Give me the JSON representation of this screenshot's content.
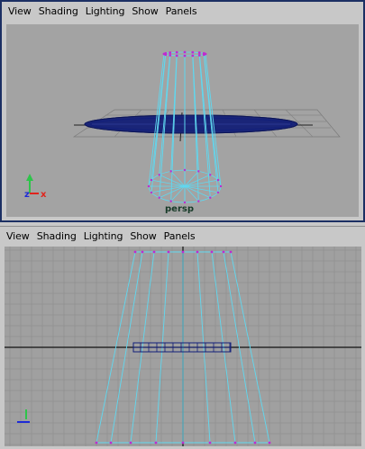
{
  "top_panel": {
    "menu": [
      "View",
      "Shading",
      "Lighting",
      "Show",
      "Panels"
    ],
    "camera_label": "persp",
    "axis_labels": {
      "y": "y",
      "z": "z",
      "x": "x"
    }
  },
  "bottom_panel": {
    "menu": [
      "View",
      "Shading",
      "Lighting",
      "Show",
      "Panels"
    ],
    "axis_labels": {
      "y": "y"
    }
  },
  "colors": {
    "viewport_bg_persp": "#a3a3a3",
    "viewport_bg_front": "#a0a0a0",
    "wire_cyan": "#5fd8f0",
    "wire_dark": "#121f7a",
    "vertex_magenta": "#c02ad0",
    "axis_x": "#e0241c",
    "axis_y": "#2ec44a",
    "axis_z": "#1e2bd6",
    "grid": "#828282",
    "active_border": "#1c2f63"
  },
  "icons": [
    "axis-gizmo-icon"
  ]
}
